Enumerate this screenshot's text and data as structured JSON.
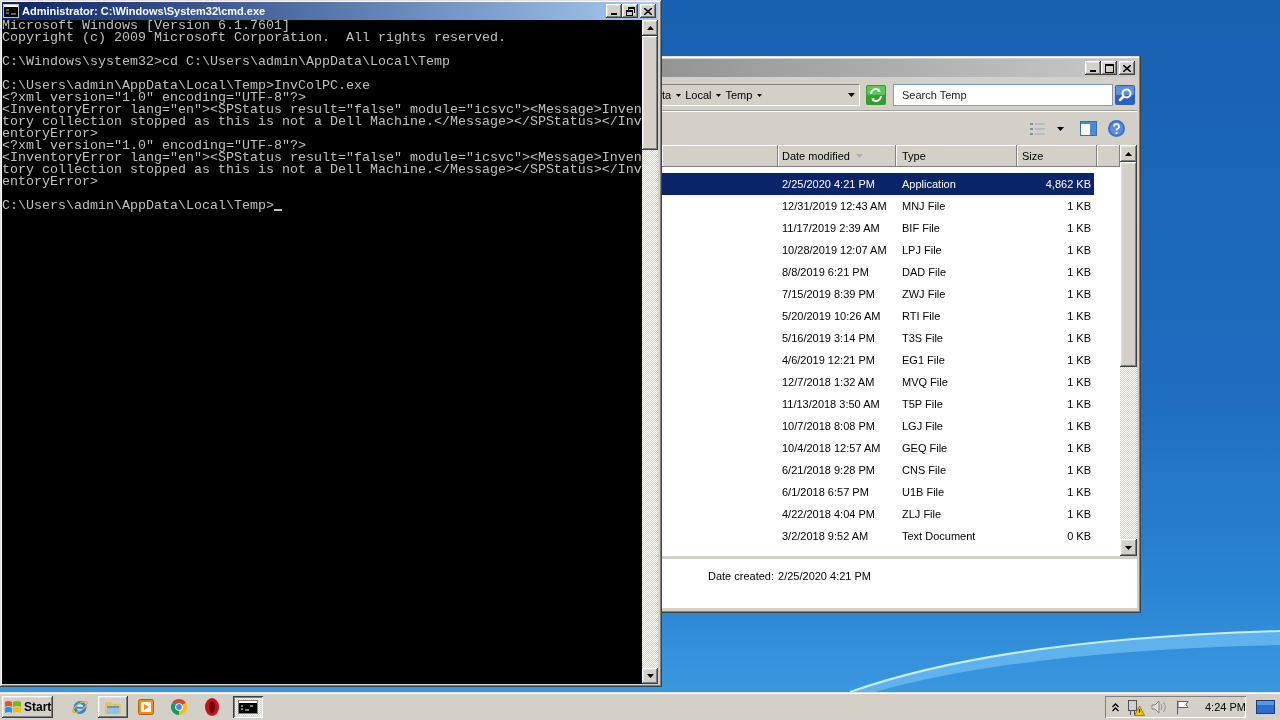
{
  "cmd_window": {
    "title": "Administrator: C:\\Windows\\System32\\cmd.exe",
    "active": true,
    "output_blocks": [
      [
        "Microsoft Windows [Version 6.1.7601]",
        "Copyright (c) 2009 Microsoft Corporation.  All rights reserved."
      ],
      [
        "C:\\Windows\\system32>cd C:\\Users\\admin\\AppData\\Local\\Temp"
      ],
      [
        "C:\\Users\\admin\\AppData\\Local\\Temp>InvColPC.exe",
        "<?xml version=\"1.0\" encoding=\"UTF-8\"?>",
        "<InventoryError lang=\"en\"><SPStatus result=\"false\" module=\"icsvc\"><Message>Inven",
        "tory collection stopped as this is not a Dell Machine.</Message></SPStatus></Inv",
        "entoryError>",
        "<?xml version=\"1.0\" encoding=\"UTF-8\"?>",
        "<InventoryError lang=\"en\"><SPStatus result=\"false\" module=\"icsvc\"><Message>Inven",
        "tory collection stopped as this is not a Dell Machine.</Message></SPStatus></Inv",
        "entoryError>"
      ],
      [
        "C:\\Users\\admin\\AppData\\Local\\Temp>"
      ]
    ],
    "cursor": true
  },
  "explorer_window": {
    "active": false,
    "address_path": [
      "ta",
      "Local",
      "Temp"
    ],
    "search": {
      "placeholder": "Search Temp"
    },
    "columns": [
      {
        "label": "Date modified",
        "sorted": true
      },
      {
        "label": "Type",
        "sorted": false
      },
      {
        "label": "Size",
        "sorted": false
      }
    ],
    "rows": [
      {
        "date_modified": "2/25/2020 4:21 PM",
        "type": "Application",
        "size": "4,862 KB",
        "selected": true
      },
      {
        "date_modified": "12/31/2019 12:43 AM",
        "type": "MNJ File",
        "size": "1 KB",
        "selected": false
      },
      {
        "date_modified": "11/17/2019 2:39 AM",
        "type": "BIF File",
        "size": "1 KB",
        "selected": false
      },
      {
        "date_modified": "10/28/2019 12:07 AM",
        "type": "LPJ File",
        "size": "1 KB",
        "selected": false
      },
      {
        "date_modified": "8/8/2019 6:21 PM",
        "type": "DAD File",
        "size": "1 KB",
        "selected": false
      },
      {
        "date_modified": "7/15/2019 8:39 PM",
        "type": "ZWJ File",
        "size": "1 KB",
        "selected": false
      },
      {
        "date_modified": "5/20/2019 10:26 AM",
        "type": "RTI File",
        "size": "1 KB",
        "selected": false
      },
      {
        "date_modified": "5/16/2019 3:14 PM",
        "type": "T3S File",
        "size": "1 KB",
        "selected": false
      },
      {
        "date_modified": "4/6/2019 12:21 PM",
        "type": "EG1 File",
        "size": "1 KB",
        "selected": false
      },
      {
        "date_modified": "12/7/2018 1:32 AM",
        "type": "MVQ File",
        "size": "1 KB",
        "selected": false
      },
      {
        "date_modified": "11/13/2018 3:50 AM",
        "type": "T5P File",
        "size": "1 KB",
        "selected": false
      },
      {
        "date_modified": "10/7/2018 8:08 PM",
        "type": "LGJ File",
        "size": "1 KB",
        "selected": false
      },
      {
        "date_modified": "10/4/2018 12:57 AM",
        "type": "GEQ File",
        "size": "1 KB",
        "selected": false
      },
      {
        "date_modified": "6/21/2018 9:28 PM",
        "type": "CNS File",
        "size": "1 KB",
        "selected": false
      },
      {
        "date_modified": "6/1/2018 6:57 PM",
        "type": "U1B File",
        "size": "1 KB",
        "selected": false
      },
      {
        "date_modified": "4/22/2018 4:04 PM",
        "type": "ZLJ File",
        "size": "1 KB",
        "selected": false
      },
      {
        "date_modified": "3/2/2018 9:52 AM",
        "type": "Text Document",
        "size": "0 KB",
        "selected": false
      }
    ],
    "details": {
      "label": "Date created:",
      "value": "2/25/2020 4:21 PM"
    }
  },
  "taskbar": {
    "start_label": "Start",
    "buttons": [
      {
        "running": false,
        "selected": false
      },
      {
        "running": true,
        "selected": false
      },
      {
        "running": false,
        "selected": false
      },
      {
        "running": false,
        "selected": false
      },
      {
        "running": false,
        "selected": false
      },
      {
        "running": true,
        "selected": true
      }
    ],
    "clock": "4:24 PM"
  }
}
